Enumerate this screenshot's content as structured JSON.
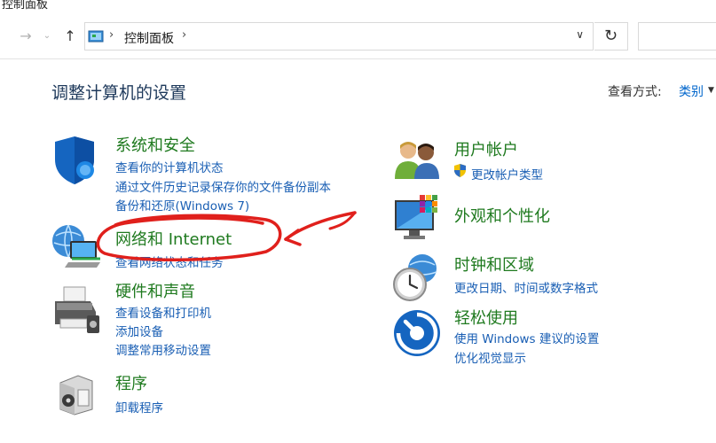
{
  "window": {
    "title": "控制面板"
  },
  "nav": {
    "back_icon": "back-arrow-icon",
    "forward_icon": "forward-arrow-icon",
    "up_icon": "up-arrow-icon",
    "address": "控制面板",
    "refresh_icon": "refresh-icon"
  },
  "main": {
    "heading": "调整计算机的设置",
    "view_by_label": "查看方式:",
    "view_by_value": "类别"
  },
  "categories_left": [
    {
      "title": "系统和安全",
      "icon": "shield-icon",
      "links": [
        "查看你的计算机状态",
        "通过文件历史记录保存你的文件备份副本",
        "备份和还原(Windows 7)"
      ]
    },
    {
      "title": "网络和 Internet",
      "icon": "network-globe-icon",
      "links": [
        "查看网络状态和任务"
      ]
    },
    {
      "title": "硬件和声音",
      "icon": "printer-icon",
      "links": [
        "查看设备和打印机",
        "添加设备",
        "调整常用移动设置"
      ]
    },
    {
      "title": "程序",
      "icon": "programs-box-icon",
      "links": [
        "卸载程序"
      ]
    }
  ],
  "categories_right": [
    {
      "title": "用户帐户",
      "icon": "users-icon",
      "links": [
        "更改帐户类型"
      ]
    },
    {
      "title": "外观和个性化",
      "icon": "monitor-palette-icon",
      "links": []
    },
    {
      "title": "时钟和区域",
      "icon": "clock-globe-icon",
      "links": [
        "更改日期、时间或数字格式"
      ]
    },
    {
      "title": "轻松使用",
      "icon": "ease-of-access-icon",
      "links": [
        "使用 Windows 建议的设置",
        "优化视觉显示"
      ]
    }
  ],
  "colors": {
    "category_title": "#1f7a1f",
    "link": "#1a5fb4",
    "heading": "#1e395b",
    "annotation": "#e0201c"
  }
}
